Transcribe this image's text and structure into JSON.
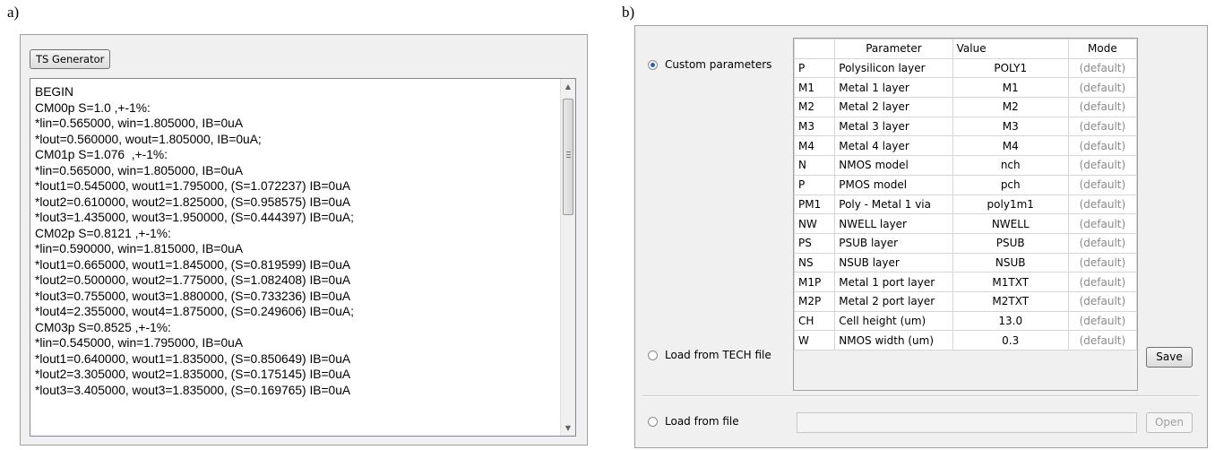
{
  "figure_labels": {
    "a": "a)",
    "b": "b)"
  },
  "panel_a": {
    "generator_button": "TS Generator",
    "output_lines": [
      "BEGIN",
      "CM00p S=1.0 ,+-1%:",
      "*lin=0.565000, win=1.805000, IB=0uA",
      "*lout=0.560000, wout=1.805000, IB=0uA;",
      "CM01p S=1.076  ,+-1%:",
      "*lin=0.565000, win=1.805000, IB=0uA",
      "*lout1=0.545000, wout1=1.795000, (S=1.072237) IB=0uA",
      "*lout2=0.610000, wout2=1.825000, (S=0.958575) IB=0uA",
      "*lout3=1.435000, wout3=1.950000, (S=0.444397) IB=0uA;",
      "CM02p S=0.8121 ,+-1%:",
      "*lin=0.590000, win=1.815000, IB=0uA",
      "*lout1=0.665000, wout1=1.845000, (S=0.819599) IB=0uA",
      "*lout2=0.500000, wout2=1.775000, (S=1.082408) IB=0uA",
      "*lout3=0.755000, wout3=1.880000, (S=0.733236) IB=0uA",
      "*lout4=2.355000, wout4=1.875000, (S=0.249606) IB=0uA;",
      "CM03p S=0.8525 ,+-1%:",
      "*lin=0.545000, win=1.795000, IB=0uA",
      "*lout1=0.640000, wout1=1.835000, (S=0.850649) IB=0uA",
      "*lout2=3.305000, wout2=1.835000, (S=0.175145) IB=0uA",
      "*lout3=3.405000, wout3=1.835000, (S=0.169765) IB=0uA"
    ]
  },
  "panel_b": {
    "radio_custom": {
      "label": "Custom parameters",
      "selected": true
    },
    "radio_tech": {
      "label": "Load from TECH file",
      "selected": false
    },
    "radio_file": {
      "label": "Load from file",
      "selected": false
    },
    "table_headers": {
      "code": "",
      "parameter": "Parameter",
      "value": "Value",
      "mode": "Mode"
    },
    "rows": [
      {
        "code": "P",
        "parameter": "Polysilicon layer",
        "value": "POLY1",
        "mode": "(default)"
      },
      {
        "code": "M1",
        "parameter": "Metal 1 layer",
        "value": "M1",
        "mode": "(default)"
      },
      {
        "code": "M2",
        "parameter": "Metal 2 layer",
        "value": "M2",
        "mode": "(default)"
      },
      {
        "code": "M3",
        "parameter": "Metal 3 layer",
        "value": "M3",
        "mode": "(default)"
      },
      {
        "code": "M4",
        "parameter": "Metal 4 layer",
        "value": "M4",
        "mode": "(default)"
      },
      {
        "code": "N",
        "parameter": "NMOS model",
        "value": "nch",
        "mode": "(default)"
      },
      {
        "code": "P",
        "parameter": "PMOS model",
        "value": "pch",
        "mode": "(default)"
      },
      {
        "code": "PM1",
        "parameter": "Poly - Metal 1 via",
        "value": "poly1m1",
        "mode": "(default)"
      },
      {
        "code": "NW",
        "parameter": "NWELL layer",
        "value": "NWELL",
        "mode": "(default)"
      },
      {
        "code": "PS",
        "parameter": "PSUB layer",
        "value": "PSUB",
        "mode": "(default)"
      },
      {
        "code": "NS",
        "parameter": "NSUB layer",
        "value": "NSUB",
        "mode": "(default)"
      },
      {
        "code": "M1P",
        "parameter": "Metal 1 port layer",
        "value": "M1TXT",
        "mode": "(default)"
      },
      {
        "code": "M2P",
        "parameter": "Metal 2 port layer",
        "value": "M2TXT",
        "mode": "(default)"
      },
      {
        "code": "CH",
        "parameter": "Cell height (um)",
        "value": "13.0",
        "mode": "(default)"
      },
      {
        "code": "W",
        "parameter": "NMOS width (um)",
        "value": "0.3",
        "mode": "(default)"
      }
    ],
    "save_button": "Save",
    "file_path_value": "",
    "open_button": "Open"
  }
}
